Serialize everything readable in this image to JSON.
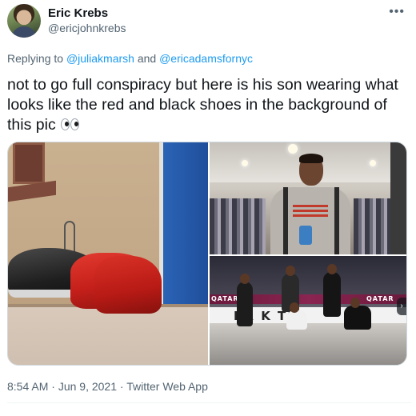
{
  "author": {
    "name": "Eric Krebs",
    "handle": "@ericjohnkrebs"
  },
  "reply": {
    "prefix": "Replying to",
    "mention1": "@juliakmarsh",
    "conjunction": "and",
    "mention2": "@ericadamsfornyc"
  },
  "tweet": {
    "text": "not to go full conspiracy but here is his son wearing what looks like the red and black shoes in the background of this pic",
    "emoji": "eyes"
  },
  "media": {
    "photo2_shirt_text": "",
    "photo3_banner_left": "QATAR",
    "photo3_banner_right": "QATAR",
    "photo3_board_text": "BR     K      TS"
  },
  "footer": {
    "time": "8:54 AM",
    "separator": "·",
    "date": "Jun 9, 2021",
    "source": "Twitter Web App"
  },
  "icons": {
    "more": "more-horizontal-icon",
    "next": "chevron-right-icon"
  },
  "colors": {
    "link": "#1d9bf0",
    "secondary_text": "#536471",
    "primary_text": "#0f1419"
  }
}
